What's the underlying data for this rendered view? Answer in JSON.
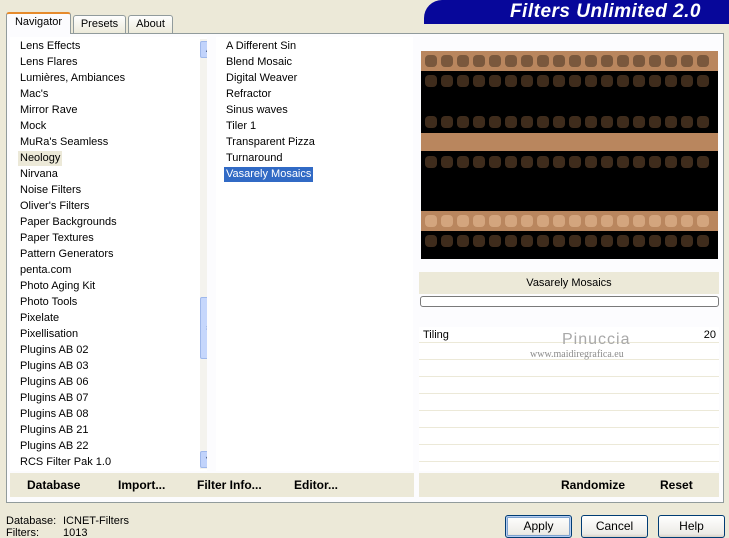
{
  "tabs": [
    "Navigator",
    "Presets",
    "About"
  ],
  "banner_title": "Filters Unlimited 2.0",
  "categories": [
    "Lens Effects",
    "Lens Flares",
    "Lumières, Ambiances",
    "Mac's",
    "Mirror Rave",
    "Mock",
    "MuRa's Seamless",
    "Neology",
    "Nirvana",
    "Noise Filters",
    "Oliver's Filters",
    "Paper Backgrounds",
    "Paper Textures",
    "Pattern Generators",
    "penta.com",
    "Photo Aging Kit",
    "Photo Tools",
    "Pixelate",
    "Pixellisation",
    "Plugins AB 02",
    "Plugins AB 03",
    "Plugins AB 06",
    "Plugins AB 07",
    "Plugins AB 08",
    "Plugins AB 21",
    "Plugins AB 22",
    "RCS Filter Pak 1.0"
  ],
  "selected_category": "Neology",
  "filters": [
    "A Different Sin",
    "Blend Mosaic",
    "Digital Weaver",
    "Refractor",
    "Sinus waves",
    "Tiler 1",
    "Transparent Pizza",
    "Turnaround",
    "Vasarely Mosaics"
  ],
  "selected_filter": "Vasarely Mosaics",
  "filter_name": "Vasarely Mosaics",
  "parameter": {
    "name": "Tiling",
    "value": "20"
  },
  "watermark": {
    "name": "Pinuccia",
    "url": "www.maidiregrafica.eu"
  },
  "actions_left": [
    "Database",
    "Import...",
    "Filter Info...",
    "Editor..."
  ],
  "actions_right": [
    "Randomize",
    "Reset"
  ],
  "status": {
    "database_label": "Database:",
    "database_value": "ICNET-Filters",
    "filters_label": "Filters:",
    "filters_value": "1013"
  },
  "buttons": {
    "apply": "Apply",
    "cancel": "Cancel",
    "help": "Help"
  },
  "colors": {
    "brown_light": "#b9865e",
    "brown_dark": "#3f2c1c",
    "selection": "#316ac5",
    "banner": "#07079a"
  }
}
